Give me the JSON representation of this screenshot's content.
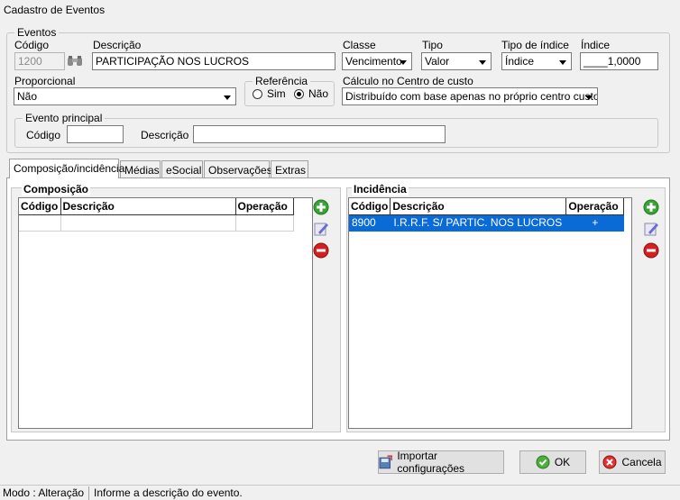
{
  "window": {
    "title": "Cadastro de Eventos"
  },
  "eventos": {
    "legend": "Eventos",
    "codigo_label": "Código",
    "codigo_value": "1200",
    "descricao_label": "Descrição",
    "descricao_value": "PARTICIPAÇÃO  NOS LUCROS",
    "classe_label": "Classe",
    "classe_value": "Vencimento",
    "tipo_label": "Tipo",
    "tipo_value": "Valor",
    "tipo_indice_label": "Tipo de índice",
    "tipo_indice_value": "Índice",
    "indice_label": "Índice",
    "indice_value": "____1,0000",
    "proporcional_label": "Proporcional",
    "proporcional_value": "Não",
    "referencia_legend": "Referência",
    "referencia_sim": "Sim",
    "referencia_nao": "Não",
    "calculo_label": "Cálculo no Centro de custo",
    "calculo_value": "Distribuído com base apenas no próprio centro custo"
  },
  "evento_principal": {
    "legend": "Evento principal",
    "codigo_label": "Código",
    "codigo_value": "",
    "descricao_label": "Descrição",
    "descricao_value": ""
  },
  "tabs": [
    {
      "label": "Composição/incidência"
    },
    {
      "label": "Médias"
    },
    {
      "label": "eSocial"
    },
    {
      "label": "Observações"
    },
    {
      "label": "Extras"
    }
  ],
  "composicao": {
    "title": "Composição",
    "columns": [
      "Código",
      "Descrição",
      "Operação"
    ]
  },
  "incidencia": {
    "title": "Incidência",
    "columns": [
      "Código",
      "Descrição",
      "Operação"
    ],
    "rows": [
      {
        "codigo": "8900",
        "descricao": "I.R.R.F. S/ PARTIC. NOS LUCROS",
        "operacao": "+"
      }
    ]
  },
  "buttons": {
    "importar": "Importar configurações",
    "ok": "OK",
    "cancela": "Cancela"
  },
  "status": {
    "mode": "Modo : Alteração",
    "message": "Informe a descrição do evento."
  },
  "icons": {
    "search": "binoculars-icon",
    "add": "add-icon",
    "edit": "edit-icon",
    "remove": "remove-icon"
  }
}
